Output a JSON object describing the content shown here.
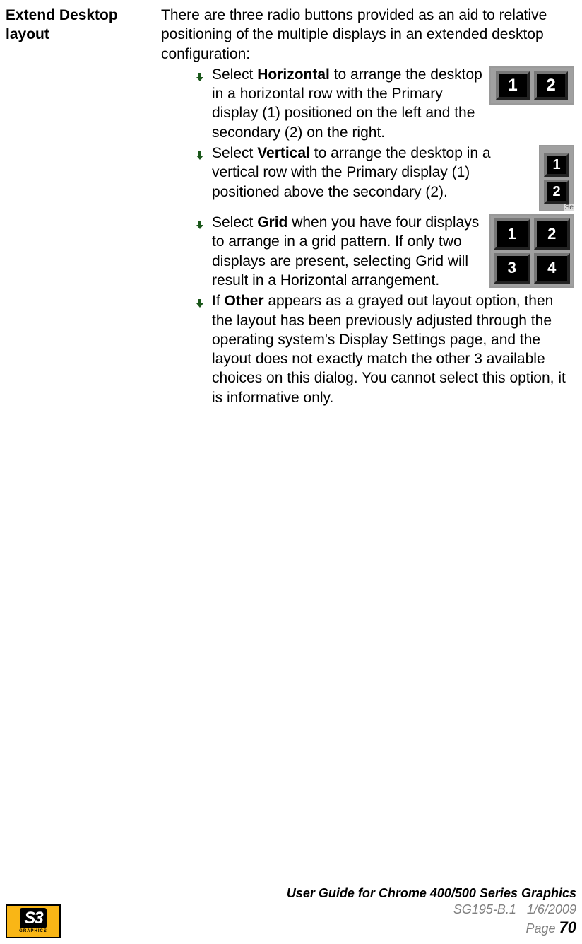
{
  "section": {
    "title_line1": "Extend Desktop",
    "title_line2": "layout",
    "intro": "There are three radio buttons provided as an aid to relative positioning of the multiple displays in an extended desktop configuration:",
    "bullets": [
      {
        "prefix": "Select ",
        "bold": "Horizontal",
        "rest": " to arrange the desktop in a horizontal row with the Primary display (1) positioned on the left and the secondary (2) on the right."
      },
      {
        "prefix": "Select ",
        "bold": "Vertical",
        "rest": " to arrange the desktop in a vertical row with the Primary display (1) positioned above the secondary (2)."
      },
      {
        "prefix": "Select ",
        "bold": "Grid",
        "rest": " when you have four displays to arrange in a grid pattern. If only two displays are present, selecting Grid will result in a Horizontal arrangement."
      },
      {
        "prefix": "If ",
        "bold": "Other",
        "rest": " appears as a grayed out layout option, then the layout has been previously adjusted through the operating system's Display Settings page, and the layout does not exactly match the other 3 available choices on this dialog. You cannot select this option, it is informative only."
      }
    ]
  },
  "images": {
    "horizontal": {
      "tiles": [
        "1",
        "2"
      ]
    },
    "vertical": {
      "tiles": [
        "1",
        "2"
      ],
      "suffix": "Se"
    },
    "grid": {
      "tiles": [
        "1",
        "2",
        "3",
        "4"
      ]
    }
  },
  "footer": {
    "logo_main": "S3",
    "logo_sub": "GRAPHICS",
    "title": "User Guide for Chrome 400/500 Series Graphics",
    "doc_id": "SG195-B.1",
    "date": "1/6/2009",
    "page_label": "Page ",
    "page_num": "70"
  }
}
